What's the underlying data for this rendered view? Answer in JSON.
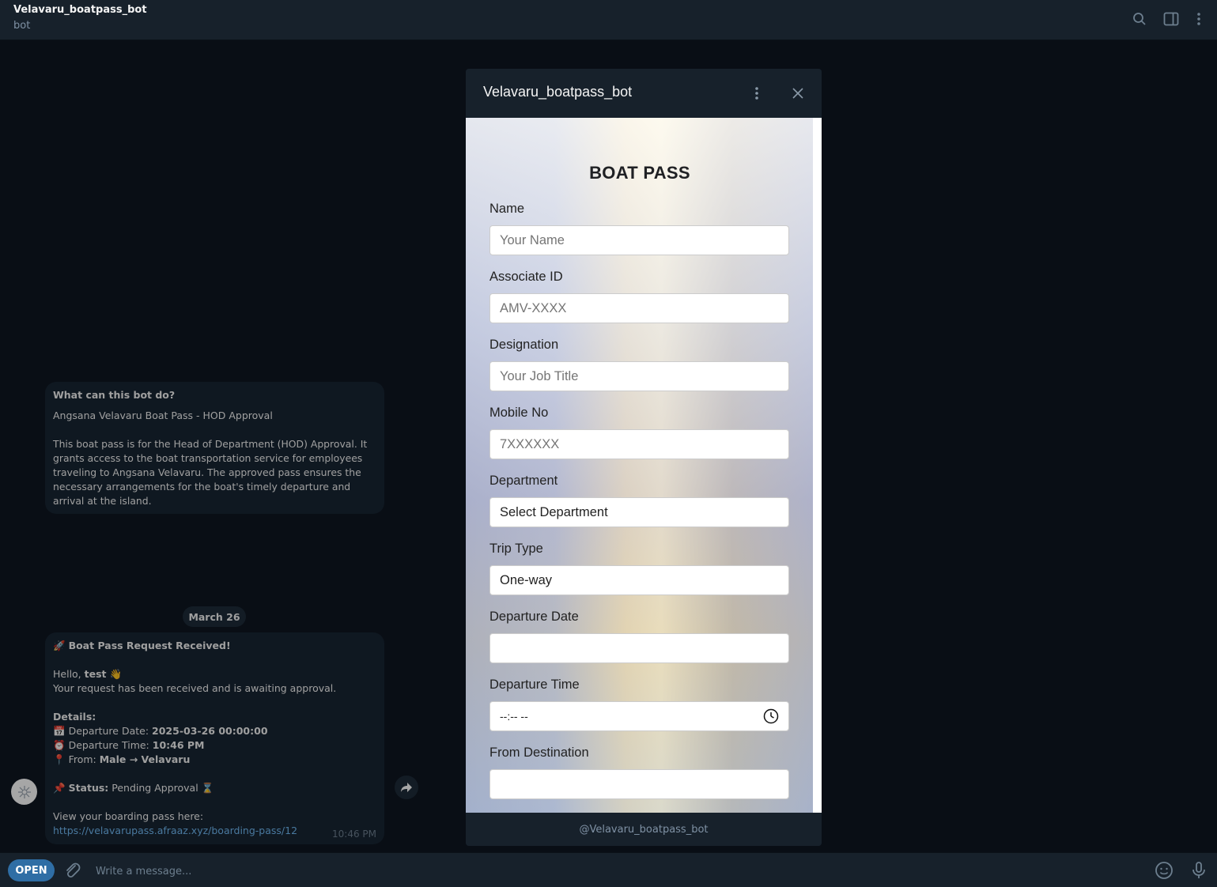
{
  "header": {
    "title": "Velavaru_boatpass_bot",
    "subtitle": "bot"
  },
  "bot_info": {
    "heading": "What can this bot do?",
    "line1": "Angsana Velavaru Boat Pass - HOD Approval",
    "body": "This boat pass is for the Head of Department (HOD) Approval. It grants access to the boat transportation service for employees traveling to Angsana Velavaru. The approved pass ensures the necessary arrangements for the boat's timely departure and arrival at the island."
  },
  "date_chip": "March 26",
  "message": {
    "title_emoji": "🚀",
    "title": "Boat Pass Request Received!",
    "hello_prefix": "Hello, ",
    "hello_name": "test",
    "hello_emoji": "👋",
    "received_line": "Your request has been received and is awaiting approval.",
    "details_label": "Details:",
    "date_emoji": "📅",
    "date_label": "Departure Date: ",
    "date_value": "2025-03-26 00:00:00",
    "time_emoji": "⏰",
    "time_label": "Departure Time: ",
    "time_value": "10:46 PM",
    "from_emoji": "📍",
    "from_label": "From: ",
    "from_value": "Male → Velavaru",
    "status_emoji": "📌",
    "status_label": "Status:",
    "status_value": " Pending Approval ",
    "status_emoji2": "⌛",
    "view_line": "View your boarding pass here:",
    "link": "https://velavarupass.afraaz.xyz/boarding-pass/12",
    "time": "10:46 PM"
  },
  "modal": {
    "title": "Velavaru_boatpass_bot",
    "footer": "@Velavaru_boatpass_bot",
    "form": {
      "heading": "BOAT PASS",
      "name_label": "Name",
      "name_placeholder": "Your Name",
      "associate_label": "Associate ID",
      "associate_placeholder": "AMV-XXXX",
      "designation_label": "Designation",
      "designation_placeholder": "Your Job Title",
      "mobile_label": "Mobile No",
      "mobile_placeholder": "7XXXXXX",
      "department_label": "Department",
      "department_value": "Select Department",
      "trip_label": "Trip Type",
      "trip_value": "One-way",
      "dep_date_label": "Departure Date",
      "dep_date_value": "",
      "dep_time_label": "Departure Time",
      "dep_time_value": "--:-- --",
      "from_label": "From Destination",
      "from_value": ""
    }
  },
  "composer": {
    "open_label": "OPEN",
    "placeholder": "Write a message..."
  }
}
